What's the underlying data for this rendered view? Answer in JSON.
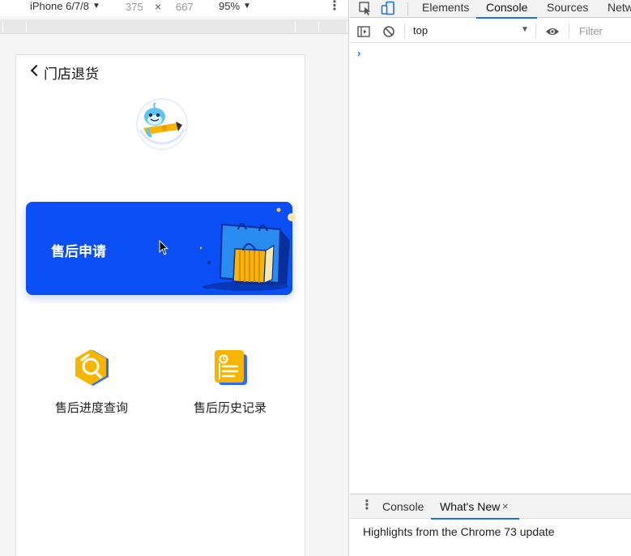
{
  "device_toolbar": {
    "device_name": "iPhone 6/7/8",
    "width": "375",
    "times": "×",
    "height": "667",
    "zoom": "95%",
    "more": "⋮"
  },
  "app": {
    "page_title": "门店退货",
    "banner_label": "售后申请",
    "features": [
      {
        "label": "售后进度查询",
        "icon": "search-progress-icon"
      },
      {
        "label": "售后历史记录",
        "icon": "history-record-icon"
      }
    ],
    "colors": {
      "banner": "#0a4ef5",
      "icon_yellow": "#f7b500",
      "icon_blue": "#2f6df6"
    }
  },
  "devtools": {
    "tabs": [
      "Elements",
      "Console",
      "Sources",
      "Netw"
    ],
    "active_tab": "Console",
    "context": "top",
    "filter_placeholder": "Filter",
    "prompt": "›",
    "drawer": {
      "tabs": [
        "Console",
        "What's New"
      ],
      "active_tab": "What's New",
      "close": "×",
      "message": "Highlights from the Chrome 73 update"
    },
    "accent": "#1a73e8"
  }
}
